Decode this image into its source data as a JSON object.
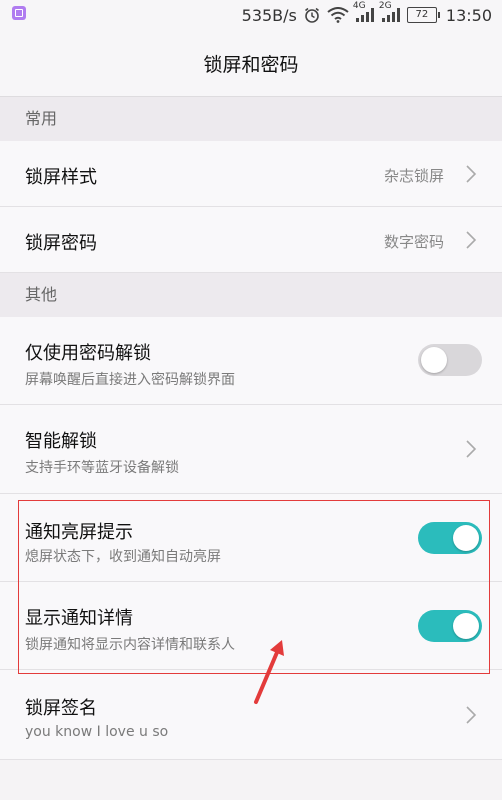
{
  "status_bar": {
    "speed": "535B/s",
    "net_4g": "4G",
    "net_2g": "2G",
    "battery": "72",
    "time": "13:50"
  },
  "title": "锁屏和密码",
  "sections": {
    "common": "常用",
    "other": "其他"
  },
  "rows": {
    "lock_style": {
      "title": "锁屏样式",
      "value": "杂志锁屏"
    },
    "lock_password": {
      "title": "锁屏密码",
      "value": "数字密码"
    },
    "password_only": {
      "title": "仅使用密码解锁",
      "subtitle": "屏幕唤醒后直接进入密码解锁界面",
      "enabled": false
    },
    "smart_unlock": {
      "title": "智能解锁",
      "subtitle": "支持手环等蓝牙设备解锁"
    },
    "notify_wake": {
      "title": "通知亮屏提示",
      "subtitle": "熄屏状态下，收到通知自动亮屏",
      "enabled": true
    },
    "notify_details": {
      "title": "显示通知详情",
      "subtitle": "锁屏通知将显示内容详情和联系人",
      "enabled": true
    },
    "lock_signature": {
      "title": "锁屏签名",
      "subtitle": "you know  I  love u so"
    }
  },
  "colors": {
    "toggle_on": "#2bbcbc",
    "toggle_off": "#d9d7da",
    "annotation": "#e33b3b"
  }
}
